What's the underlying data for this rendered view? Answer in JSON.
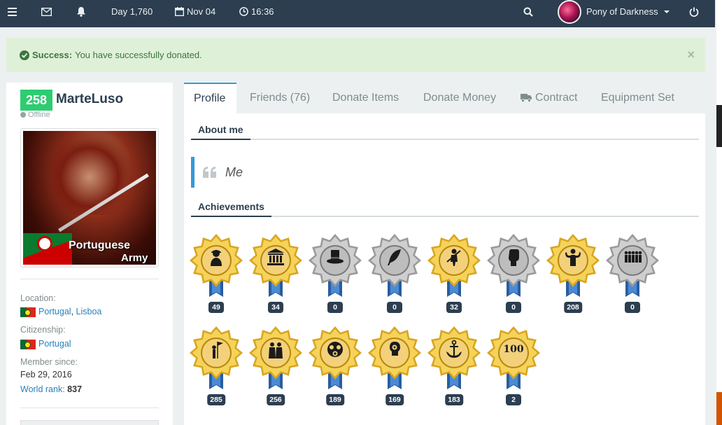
{
  "topbar": {
    "day": "Day 1,760",
    "date": "Nov 04",
    "time": "16:36",
    "user": "Pony of Darkness"
  },
  "alert": {
    "title": "Success:",
    "message": "You have successfully donated.",
    "close": "×"
  },
  "profile": {
    "level": "258",
    "name": "MarteLuso",
    "status": "Offline",
    "photo_text_1": "Portuguese",
    "photo_text_2": "Army",
    "location_label": "Location:",
    "location_country": "Portugal",
    "location_separator": ",",
    "location_region": "Lisboa",
    "citizenship_label": "Citizenship:",
    "citizenship": "Portugal",
    "member_since_label": "Member since:",
    "member_since": "Feb 29, 2016",
    "world_rank_label": "World rank:",
    "world_rank": "837"
  },
  "tabs": [
    {
      "label": "Profile"
    },
    {
      "label": "Friends (76)"
    },
    {
      "label": "Donate Items"
    },
    {
      "label": "Donate Money"
    },
    {
      "label": "Contract"
    },
    {
      "label": "Equipment Set"
    }
  ],
  "about": {
    "title": "About me",
    "text": "Me"
  },
  "achievements": {
    "title": "Achievements",
    "items": [
      {
        "icon": "worker-icon",
        "count": "49",
        "tier": "gold"
      },
      {
        "icon": "congress-icon",
        "count": "34",
        "tier": "gold"
      },
      {
        "icon": "top-hat-icon",
        "count": "0",
        "tier": "silver"
      },
      {
        "icon": "feather-icon",
        "count": "0",
        "tier": "silver"
      },
      {
        "icon": "soldier-icon",
        "count": "32",
        "tier": "gold"
      },
      {
        "icon": "fist-icon",
        "count": "0",
        "tier": "silver"
      },
      {
        "icon": "strongman-icon",
        "count": "208",
        "tier": "gold"
      },
      {
        "icon": "group-icon",
        "count": "0",
        "tier": "silver"
      },
      {
        "icon": "flag-bearer-icon",
        "count": "285",
        "tier": "gold"
      },
      {
        "icon": "friends-icon",
        "count": "256",
        "tier": "gold"
      },
      {
        "icon": "gas-mask-icon",
        "count": "189",
        "tier": "gold"
      },
      {
        "icon": "brain-icon",
        "count": "169",
        "tier": "gold"
      },
      {
        "icon": "anchor-icon",
        "count": "183",
        "tier": "gold"
      },
      {
        "icon": "hundred-icon",
        "count": "2",
        "tier": "gold",
        "label": "100"
      }
    ]
  },
  "colors": {
    "topbar": "#2c3e50",
    "success_bg": "#dff0d8",
    "success_text": "#3c763d",
    "level_badge": "#2ecc71",
    "accent": "#3498db",
    "link": "#2980b9"
  }
}
